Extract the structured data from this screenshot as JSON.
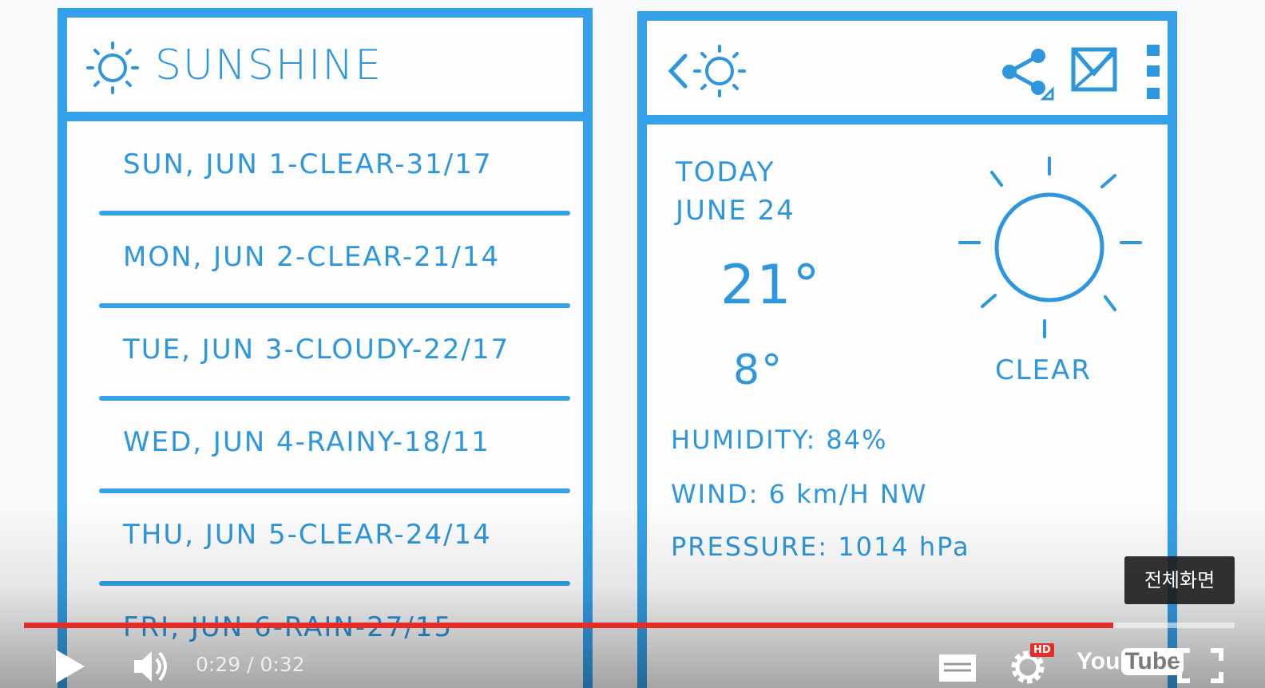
{
  "colors": {
    "sketch_blue": "#35a0e8",
    "progress_red": "#e52d27"
  },
  "list_screen": {
    "app_title": "SUNSHINE",
    "forecast": [
      "SUN, JUN 1-CLEAR-31/17",
      "MON, JUN 2-CLEAR-21/14",
      "TUE, JUN 3-CLOUDY-22/17",
      "WED, JUN 4-RAINY-18/11",
      "THU, JUN 5-CLEAR-24/14",
      "FRI, JUN 6-RAIN-27/15"
    ]
  },
  "detail_screen": {
    "day": "TODAY",
    "date": "JUNE 24",
    "high": "21°",
    "low": "8°",
    "condition": "CLEAR",
    "humidity": "HUMIDITY: 84%",
    "wind": "WIND: 6 km/H NW",
    "pressure": "PRESSURE: 1014 hPa",
    "icons": [
      "back-icon",
      "sun-icon",
      "share-icon",
      "map-icon",
      "overflow-menu-icon"
    ]
  },
  "player": {
    "current_time": "0:29",
    "separator": " / ",
    "duration": "0:32",
    "progress": 0.9,
    "tooltip": "전체화면",
    "hd_label": "HD",
    "logo_you": "You",
    "logo_tube": "Tube"
  }
}
